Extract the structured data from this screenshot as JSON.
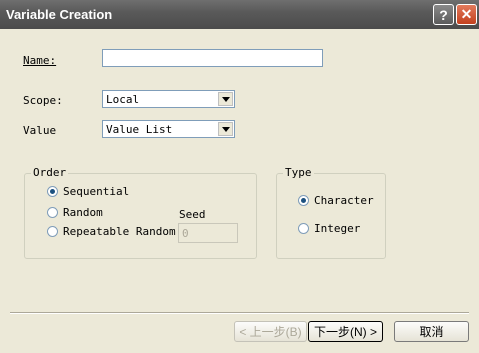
{
  "window": {
    "title": "Variable Creation"
  },
  "titlebar": {
    "help_label": "?",
    "close_label": "✕"
  },
  "form": {
    "name_label": "Name:",
    "name_value": "",
    "scope_label": "Scope:",
    "scope_value": "Local",
    "value_label": "Value",
    "value_value": "Value List"
  },
  "order": {
    "legend": "Order",
    "options": [
      "Sequential",
      "Random",
      "Repeatable Random"
    ],
    "selected": "Sequential",
    "seed_label": "Seed",
    "seed_value": "0"
  },
  "type": {
    "legend": "Type",
    "options": [
      "Character",
      "Integer"
    ],
    "selected": "Character"
  },
  "buttons": {
    "back": "< 上一步(B)",
    "next": "下一步(N) >",
    "cancel": "取消"
  }
}
